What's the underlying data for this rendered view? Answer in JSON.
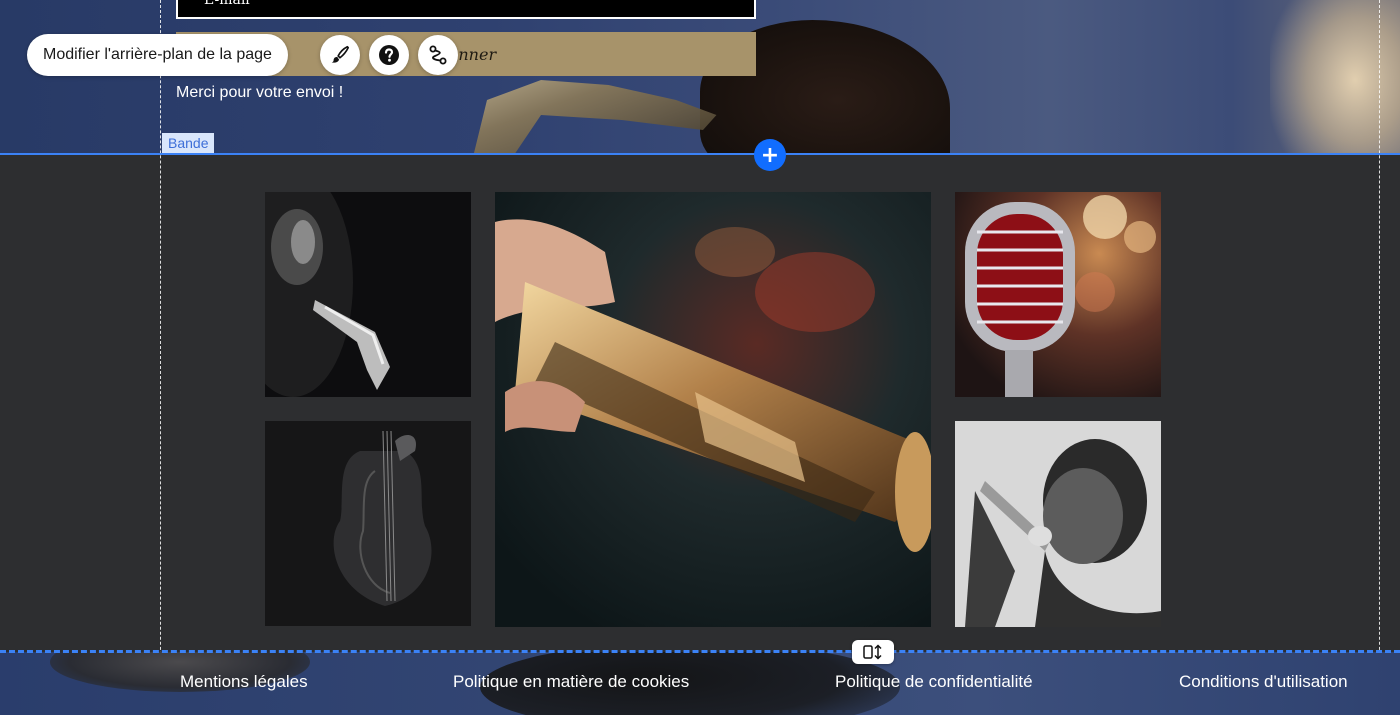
{
  "hero": {
    "field_value": "E-mail",
    "submit_label": "Donner",
    "thanks_message": "Merci pour votre envoi !"
  },
  "editor": {
    "change_background_label": "Modifier l'arrière-plan de la page",
    "strip_label": "Bande",
    "add_section_glyph": "+",
    "icons": {
      "design": "paintbrush-icon",
      "help": "question-mark-icon",
      "animation": "animation-path-icon",
      "resize": "resize-vertical-icon"
    }
  },
  "gallery": {
    "images": [
      "saxophone-player-bw",
      "trumpet-closeup",
      "vintage-microphone",
      "double-bass-bw",
      "saxophone-player-singing-bw"
    ]
  },
  "footer": {
    "links": [
      "Mentions légales",
      "Politique en matière de cookies",
      "Politique de confidentialité",
      "Conditions d'utilisation"
    ]
  },
  "colors": {
    "accent": "#116dff",
    "selection_line": "#3b82f6",
    "submit_button": "#a7936a",
    "section_background": "#2d2e30"
  }
}
